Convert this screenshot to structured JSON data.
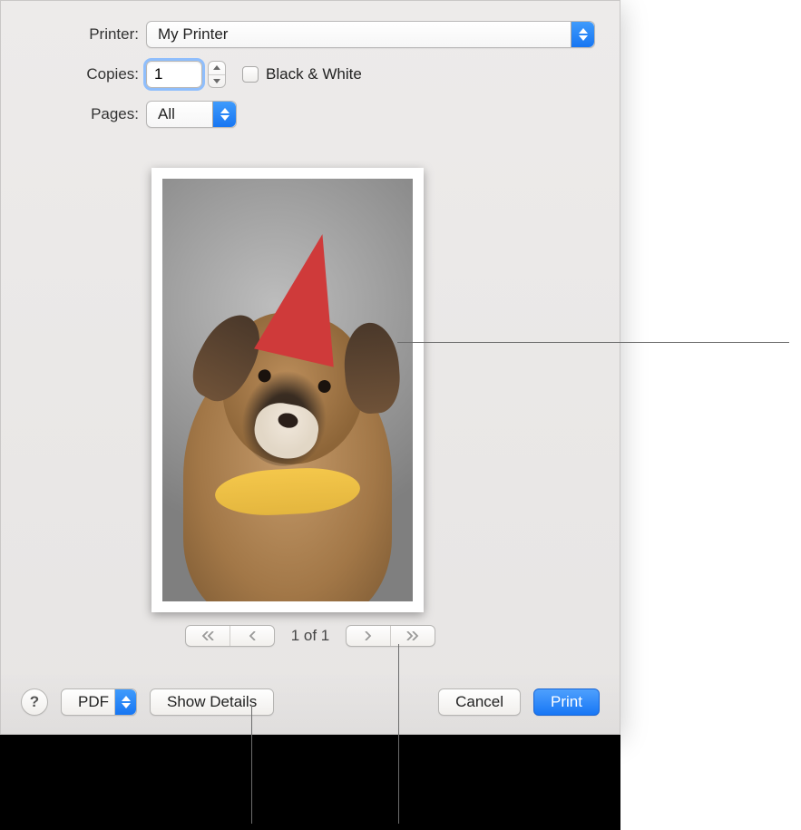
{
  "labels": {
    "printer": "Printer:",
    "copies": "Copies:",
    "pages": "Pages:",
    "bw": "Black & White"
  },
  "printer": {
    "selected": "My Printer"
  },
  "copies": {
    "value": "1"
  },
  "pages": {
    "selected": "All"
  },
  "pager": {
    "text": "1 of 1"
  },
  "bottom": {
    "help": "?",
    "pdf": "PDF",
    "show_details": "Show Details",
    "cancel": "Cancel",
    "print": "Print"
  }
}
